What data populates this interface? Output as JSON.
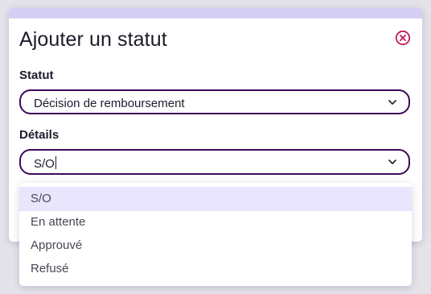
{
  "modal": {
    "title": "Ajouter un statut",
    "close_icon": "close-circle-icon"
  },
  "statut_field": {
    "label": "Statut",
    "value": "Décision de remboursement"
  },
  "details_field": {
    "label": "Détails",
    "value": "S/O"
  },
  "dropdown": {
    "selected_index": 0,
    "options": [
      {
        "label": "S/O"
      },
      {
        "label": "En attente"
      },
      {
        "label": "Approuvé"
      },
      {
        "label": "Refusé"
      }
    ]
  },
  "colors": {
    "accent": "#3c0b57",
    "close_icon": "#c2185b",
    "topbar": "#d5cff5",
    "option_highlight": "#e9e5fc"
  }
}
